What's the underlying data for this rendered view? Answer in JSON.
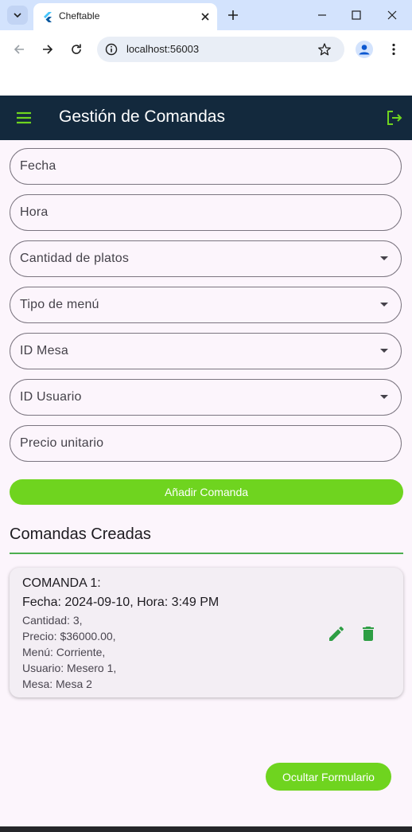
{
  "browser": {
    "tab_title": "Cheftable",
    "url": "localhost:56003"
  },
  "app": {
    "title": "Gestión de Comandas",
    "accent_color": "#6fd41f",
    "appbar_color": "#13293d"
  },
  "form": {
    "fecha_label": "Fecha",
    "hora_label": "Hora",
    "cantidad_label": "Cantidad de platos",
    "tipo_menu_label": "Tipo de menú",
    "id_mesa_label": "ID Mesa",
    "id_usuario_label": "ID Usuario",
    "precio_label": "Precio unitario",
    "add_button": "Añadir Comanda"
  },
  "orders": {
    "section_title": "Comandas Creadas",
    "items": [
      {
        "title": "COMANDA 1:",
        "datetime": "Fecha: 2024-09-10, Hora: 3:49 PM",
        "cantidad": "Cantidad: 3,",
        "precio": "Precio: $36000.00,",
        "menu": "Menú: Corriente,",
        "usuario": "Usuario: Mesero 1,",
        "mesa": "Mesa: Mesa 2"
      }
    ]
  },
  "hide_button": "Ocultar Formulario"
}
